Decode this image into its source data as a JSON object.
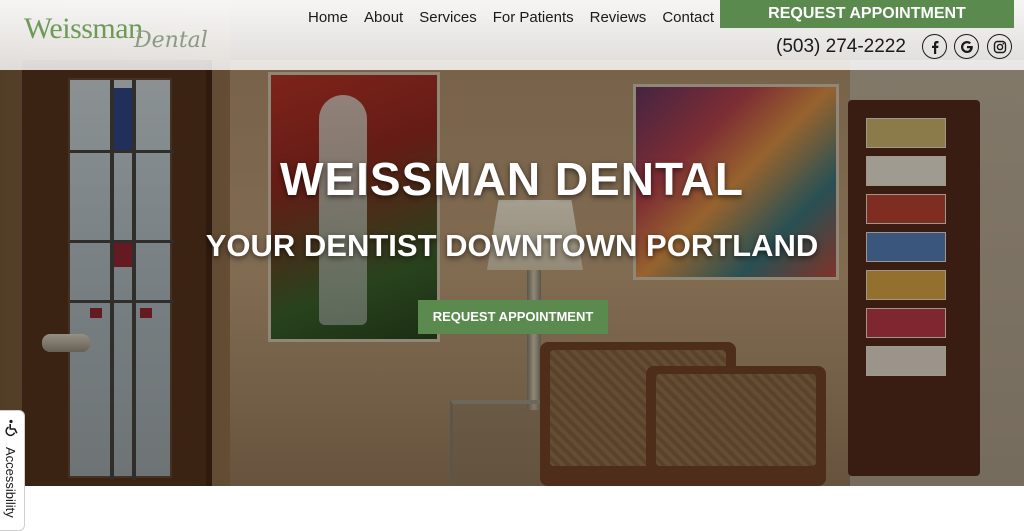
{
  "brand": {
    "logo_main": "Weissman",
    "logo_sub": "Dental",
    "accent_color": "#5a8a4e",
    "logo_color": "#6d9a58"
  },
  "nav": {
    "items": [
      {
        "label": "Home"
      },
      {
        "label": "About"
      },
      {
        "label": "Services"
      },
      {
        "label": "For Patients"
      },
      {
        "label": "Reviews"
      },
      {
        "label": "Contact"
      }
    ]
  },
  "header": {
    "request_label": "REQUEST APPOINTMENT",
    "phone": "(503) 274-2222",
    "social": [
      {
        "icon": "facebook-icon"
      },
      {
        "icon": "google-icon"
      },
      {
        "icon": "instagram-icon"
      }
    ]
  },
  "hero": {
    "title": "WEISSMAN DENTAL",
    "subtitle": "YOUR DENTIST DOWNTOWN PORTLAND",
    "button_label": "REQUEST APPOINTMENT"
  },
  "accessibility": {
    "label": "Accessibility",
    "icon": "wheelchair-icon"
  }
}
